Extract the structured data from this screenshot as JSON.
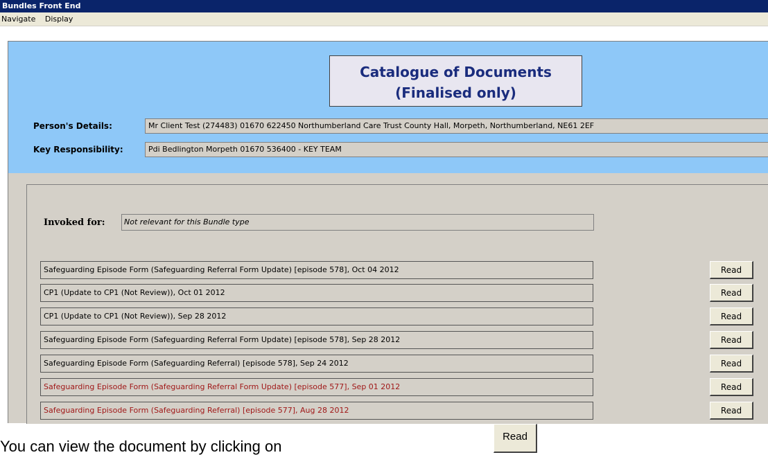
{
  "window": {
    "title": "Bundles Front End"
  },
  "menu": {
    "items": [
      "Navigate",
      "Display"
    ]
  },
  "heading": {
    "line1": "Catalogue of Documents",
    "line2": "(Finalised only)"
  },
  "person": {
    "label": "Person's Details:",
    "value": "Mr Client Test (274483) 01670 622450 Northumberland Care Trust County Hall, Morpeth, Northumberland, NE61 2EF"
  },
  "key": {
    "label": "Key Responsibility:",
    "value": "Pdi Bedlington Morpeth 01670 536400 - KEY TEAM"
  },
  "invoked": {
    "label": "Invoked for:",
    "value": "Not relevant for this Bundle type"
  },
  "documents": [
    {
      "title": "Safeguarding Episode Form (Safeguarding Referral Form Update) [episode 578], Oct 04 2012",
      "button": "Read"
    },
    {
      "title": "CP1 (Update to CP1 (Not Review)), Oct 01 2012",
      "button": "Read"
    },
    {
      "title": "CP1 (Update to CP1 (Not Review)), Sep 28 2012",
      "button": "Read"
    },
    {
      "title": "Safeguarding Episode Form (Safeguarding Referral Form Update) [episode 578], Sep 28 2012",
      "button": "Read"
    },
    {
      "title": "Safeguarding Episode Form (Safeguarding Referral) [episode 578], Sep 24 2012",
      "button": "Read"
    },
    {
      "title": "Safeguarding Episode Form (Safeguarding Referral Form Update) [episode 577], Sep 01 2012",
      "button": "Read"
    },
    {
      "title": "Safeguarding Episode Form (Safeguarding Referral) [episode 577], Aug 28 2012",
      "button": "Read"
    }
  ],
  "caption": {
    "text": "You can view the document by clicking on",
    "button": "Read"
  },
  "colors": {
    "title_bar": "#0a246a",
    "panel_blue": "#8ec8f8",
    "heading_text": "#1a2c7d",
    "red_entry": "#a01818"
  }
}
